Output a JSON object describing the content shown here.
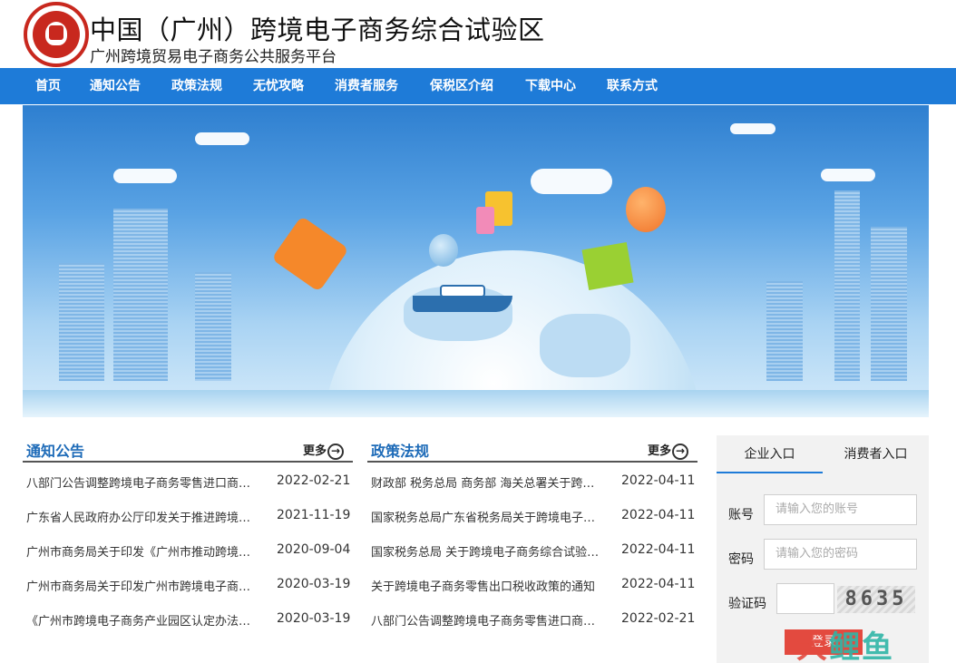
{
  "header": {
    "title": "中国（广州）跨境电子商务综合试验区",
    "subtitle": "广州跨境贸易电子商务公共服务平台"
  },
  "nav": [
    "首页",
    "通知公告",
    "政策法规",
    "无忧攻略",
    "消费者服务",
    "保税区介绍",
    "下载中心",
    "联系方式"
  ],
  "notices": {
    "title": "通知公告",
    "more": "更多",
    "items": [
      {
        "title": "八部门公告调整跨境电子商务零售进口商…",
        "date": "2022-02-21"
      },
      {
        "title": "广东省人民政府办公厅印发关于推进跨境…",
        "date": "2021-11-19"
      },
      {
        "title": "广州市商务局关于印发《广州市推动跨境…",
        "date": "2020-09-04"
      },
      {
        "title": "广州市商务局关于印发广州市跨境电子商…",
        "date": "2020-03-19"
      },
      {
        "title": "《广州市跨境电子商务产业园区认定办法…",
        "date": "2020-03-19"
      }
    ]
  },
  "policies": {
    "title": "政策法规",
    "more": "更多",
    "items": [
      {
        "title": "财政部 税务总局 商务部 海关总署关于跨…",
        "date": "2022-04-11"
      },
      {
        "title": "国家税务总局广东省税务局关于跨境电子…",
        "date": "2022-04-11"
      },
      {
        "title": "国家税务总局 关于跨境电子商务综合试验…",
        "date": "2022-04-11"
      },
      {
        "title": "关于跨境电子商务零售出口税收政策的通知",
        "date": "2022-04-11"
      },
      {
        "title": "八部门公告调整跨境电子商务零售进口商…",
        "date": "2022-02-21"
      }
    ]
  },
  "login": {
    "tab_enterprise": "企业入口",
    "tab_consumer": "消费者入口",
    "account_label": "账号",
    "account_placeholder": "请输入您的账号",
    "password_label": "密码",
    "password_placeholder": "请输入您的密码",
    "captcha_label": "验证码",
    "captcha_text": "8635",
    "submit": "登录"
  },
  "watermark": {
    "part1": "大",
    "part2": "鲤鱼"
  },
  "colors": {
    "nav": "#1e7bd8",
    "brand_red": "#c8281e",
    "title_blue": "#1e6bb8",
    "login_button": "#e34a3f"
  }
}
